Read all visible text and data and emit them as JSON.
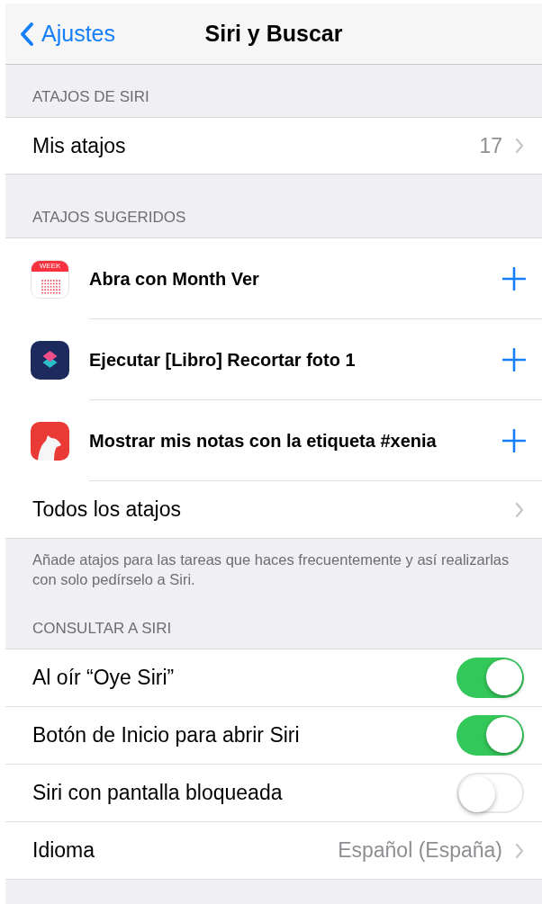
{
  "nav": {
    "back": "Ajustes",
    "title": "Siri y Buscar"
  },
  "shortcuts_section": {
    "header": "ATAJOS DE SIRI",
    "row": {
      "label": "Mis atajos",
      "value": "17"
    }
  },
  "suggested_section": {
    "header": "ATAJOS SUGERIDOS",
    "items": [
      {
        "kind": "calendar",
        "icon_text": "WEEK",
        "label": "Abra con Month Ver"
      },
      {
        "kind": "shortcuts",
        "label": "Ejecutar [Libro] Recortar foto 1"
      },
      {
        "kind": "bear",
        "label": "Mostrar mis notas con la etiqueta #xenia"
      }
    ],
    "all_row": "Todos los atajos",
    "footer": "Añade atajos para las tareas que haces frecuentemente y así realizarlas con solo pedírselo a Siri."
  },
  "ask_section": {
    "header": "CONSULTAR A SIRI",
    "rows": [
      {
        "kind": "toggle",
        "label": "Al oír “Oye Siri”",
        "on": true
      },
      {
        "kind": "toggle",
        "label": "Botón de Inicio para abrir Siri",
        "on": true
      },
      {
        "kind": "toggle",
        "label": "Siri con pantalla bloqueada",
        "on": false
      },
      {
        "kind": "link",
        "label": "Idioma",
        "value": "Español (España)"
      }
    ]
  }
}
